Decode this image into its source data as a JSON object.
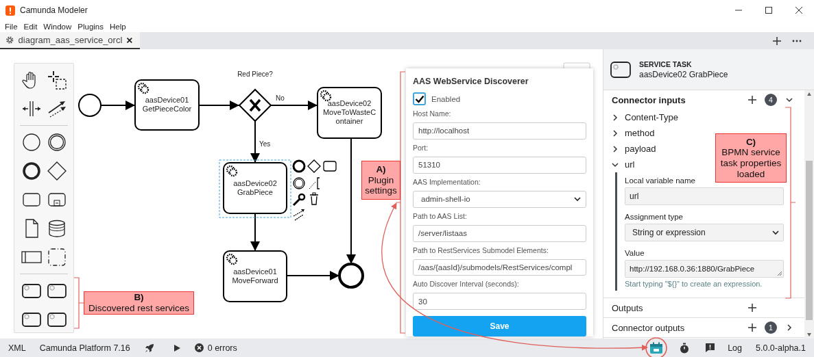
{
  "window": {
    "title": "Camunda Modeler"
  },
  "menu": [
    {
      "label": "File"
    },
    {
      "label": "Edit"
    },
    {
      "label": "Window"
    },
    {
      "label": "Plugins"
    },
    {
      "label": "Help"
    }
  ],
  "tabs": [
    {
      "label": "diagram_aas_service_orcl",
      "selected": true
    }
  ],
  "diagram": {
    "tasks": [
      {
        "lines": [
          "aasDevice01",
          "GetPieceColor"
        ],
        "selected": false
      },
      {
        "lines": [
          "aasDevice02",
          "MoveToWasteC",
          "ontainer"
        ],
        "selected": false
      },
      {
        "lines": [
          "aasDevice02",
          "GrabPiece"
        ],
        "selected": true
      },
      {
        "lines": [
          "aasDevice01",
          "MoveForward"
        ],
        "selected": false
      }
    ],
    "gateway": {
      "label": "Red Piece?"
    },
    "flows": [
      {
        "label": "No"
      },
      {
        "label": "Yes"
      }
    ]
  },
  "plugin": {
    "title": "AAS WebService Discoverer",
    "enabled": {
      "label": "Enabled",
      "checked": true
    },
    "fields": [
      {
        "label": "Host Name:",
        "value": "http://localhost",
        "kind": "input"
      },
      {
        "label": "Port:",
        "value": "51310",
        "kind": "input"
      },
      {
        "label": "AAS Implementation:",
        "value": "admin-shell-io",
        "kind": "select"
      },
      {
        "label": "Path to AAS List:",
        "value": "/server/listaas",
        "kind": "input"
      },
      {
        "label": "Path to RestServices Submodel Elements:",
        "value": "/aas/{aasId}/submodels/RestServices/compl",
        "kind": "input"
      },
      {
        "label": "Auto Discover Interval (seconds):",
        "value": "30",
        "kind": "input"
      }
    ],
    "save": "Save"
  },
  "properties": {
    "type": "SERVICE TASK",
    "name": "aasDevice02 GrabPiece",
    "groups": [
      {
        "title": "Connector inputs",
        "count": "4",
        "expanded": true,
        "items": [
          {
            "label": "Content-Type",
            "expanded": false
          },
          {
            "label": "method",
            "expanded": false
          },
          {
            "label": "payload",
            "expanded": false
          },
          {
            "label": "url",
            "expanded": true,
            "fields": [
              {
                "label": "Local variable name",
                "value": "url",
                "kind": "input"
              },
              {
                "label": "Assignment type",
                "value": "String or expression",
                "kind": "select"
              },
              {
                "label": "Value",
                "value": "http://192.168.0.36:1880/GrabPiece",
                "kind": "textarea",
                "hint": "Start typing \"${}\" to create an expression."
              }
            ]
          }
        ]
      },
      {
        "title": "Outputs",
        "expanded": false
      },
      {
        "title": "Connector outputs",
        "count": "1",
        "expanded": false
      }
    ]
  },
  "status": {
    "left": [
      {
        "label": "XML"
      },
      {
        "label": "Camunda Platform 7.16"
      }
    ],
    "errors": "0 errors",
    "right": [
      {
        "label": "Log"
      },
      {
        "label": "5.0.0-alpha.1"
      }
    ]
  },
  "annotations": [
    {
      "title": "A)",
      "text": "Plugin settings"
    },
    {
      "title": "B)",
      "text": "Discovered rest services"
    },
    {
      "title": "C)",
      "text": "BPMN service task properties loaded"
    }
  ]
}
